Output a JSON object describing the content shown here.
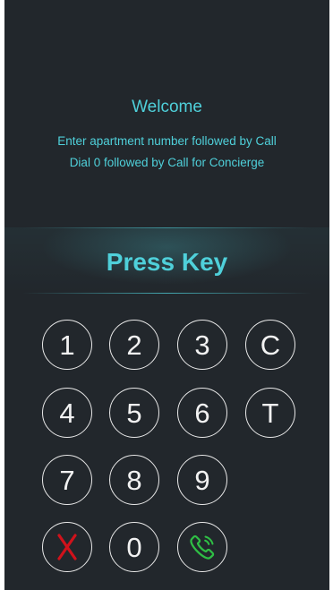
{
  "intercom": {
    "welcome_title": "Welcome",
    "instructions": [
      "Enter apartment number followed by Call",
      "Dial 0 followed by Call for Concierge"
    ],
    "prompt": "Press Key"
  },
  "keypad": {
    "keys": [
      "1",
      "2",
      "3",
      "C",
      "4",
      "5",
      "6",
      "T",
      "7",
      "8",
      "9",
      "0"
    ],
    "cancel_icon": "x-icon",
    "call_icon": "phone-icon"
  },
  "colors": {
    "background": "#22272c",
    "accent": "#4fd0da",
    "key_border": "#e8e8e8",
    "cancel": "#d0121b",
    "call": "#2fbf45"
  }
}
